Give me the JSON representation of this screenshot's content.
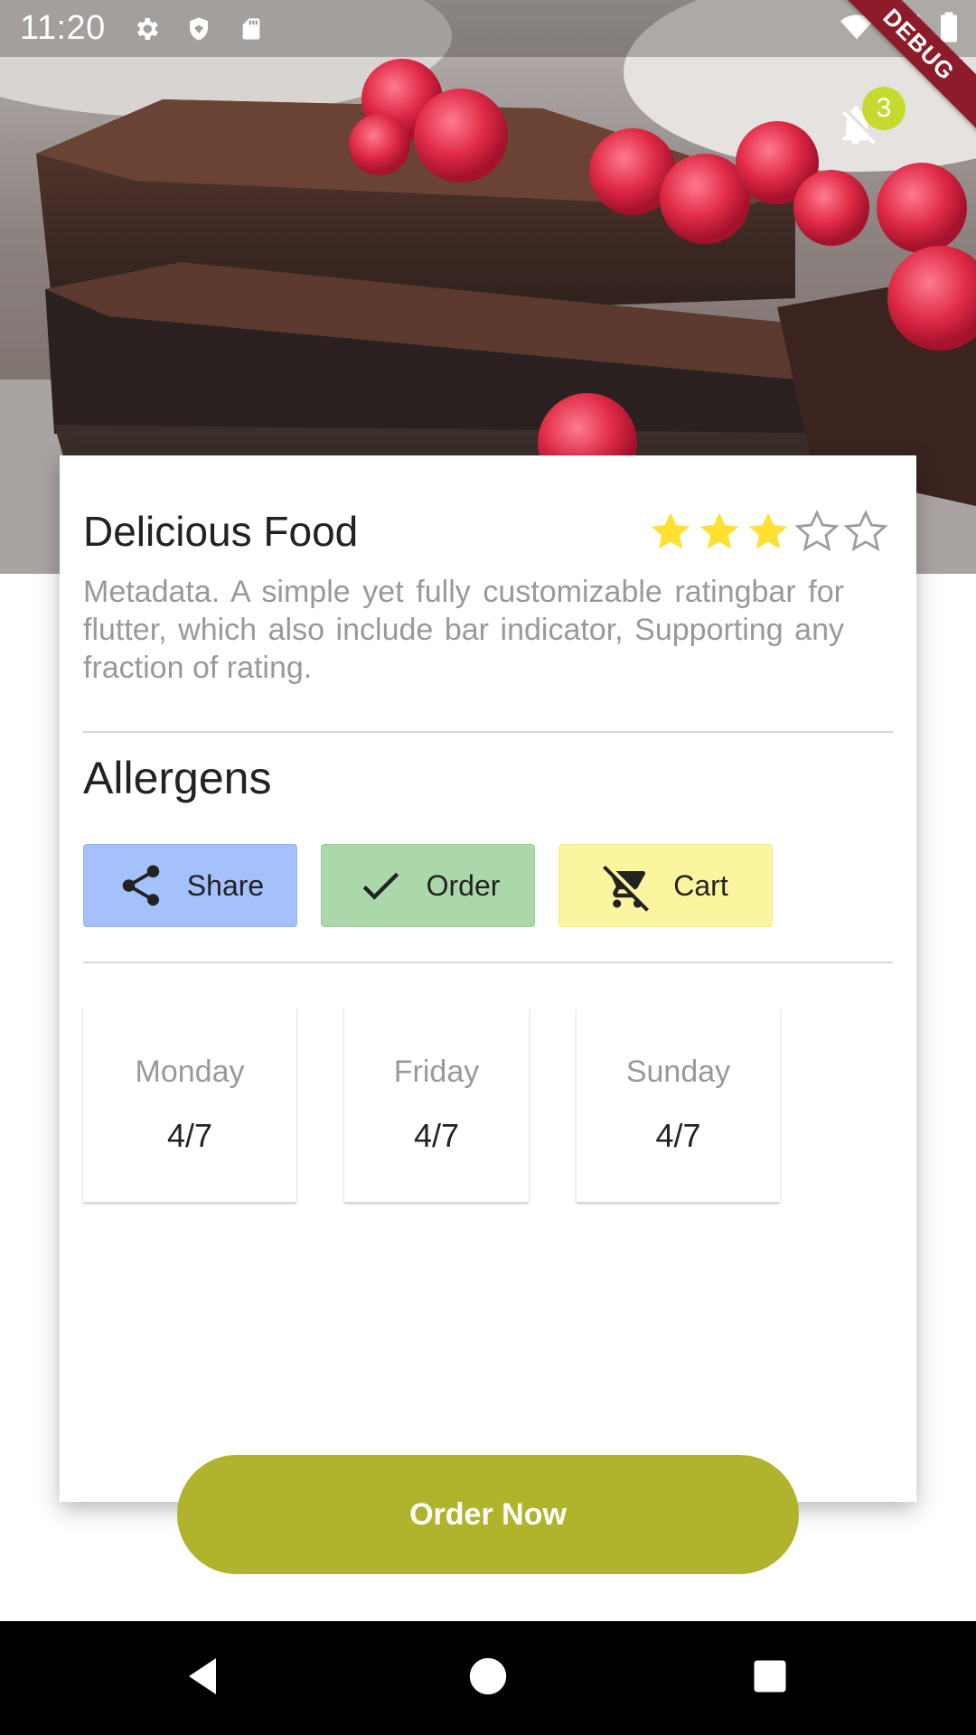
{
  "status_bar": {
    "time": "11:20",
    "icons": [
      "gear-icon",
      "shield-icon",
      "sd-card-icon",
      "wifi-icon",
      "signal-icon",
      "battery-icon"
    ]
  },
  "debug_banner": "DEBUG",
  "notifications": {
    "badge_count": "3",
    "icon": "notifications-off-icon"
  },
  "card": {
    "title": "Delicious Food",
    "rating": {
      "value": 3,
      "max": 5
    },
    "description": "Metadata. A simple yet fully customizable ratingbar for flutter, which also include bar indicator, Supporting any fraction of rating.",
    "section_title": "Allergens",
    "actions": [
      {
        "label": "Share",
        "icon": "share-icon",
        "color": "#a5c1fb"
      },
      {
        "label": "Order",
        "icon": "check-icon",
        "color": "#aad8ab"
      },
      {
        "label": "Cart",
        "icon": "remove-shopping-cart-icon",
        "color": "#fcf5a0"
      }
    ],
    "days": [
      {
        "name": "Monday",
        "value": "4/7"
      },
      {
        "name": "Friday",
        "value": "4/7"
      },
      {
        "name": "Sunday",
        "value": "4/7"
      }
    ]
  },
  "order_button": {
    "label": "Order Now",
    "color": "#b0b42c"
  },
  "nav_bar": {
    "icons": [
      "back-icon",
      "home-icon",
      "recents-icon"
    ]
  },
  "colors": {
    "star_filled": "#ffe033",
    "star_empty": "#9e9e9e"
  }
}
